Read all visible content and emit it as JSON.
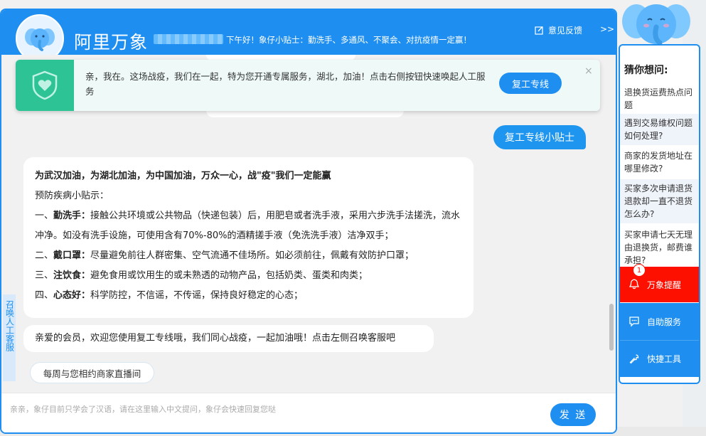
{
  "header": {
    "brand": "阿里万象",
    "greeting": "下午好！象仔小贴士：勤洗手、多通风、不聚会、对抗疫情一定赢！",
    "feedback_label": "意见反馈",
    "collapse_label": ">>"
  },
  "banner": {
    "text": "亲，我在。这场战疫，我们在一起，特为您开通专属服务，湖北，加油！点击右侧按钮快速唤起人工服务",
    "button_label": "复工专线",
    "close_label": "×"
  },
  "chat": {
    "user_message": "复工专线小贴士",
    "bot_message": {
      "title": "为武汉加油，为湖北加油，为中国加油，万众一心，战\"疫\"我们一定能赢",
      "subtitle": "预防疾病小贴示：",
      "tips": [
        {
          "prefix": "一、",
          "head": "勤洗手：",
          "body": "接触公共环境或公共物品（快递包装）后，用肥皂或者洗手液，采用六步洗手法搓洗，流水冲净。如没有洗手设施，可使用含有70%-80%的酒精搓手液（免洗洗手液）洁净双手；"
        },
        {
          "prefix": "二、",
          "head": "戴口罩：",
          "body": "尽量避免前往人群密集、空气流通不佳场所。如必须前往，佩戴有效防护口罩；"
        },
        {
          "prefix": "三、",
          "head": "注饮食：",
          "body": "避免食用或饮用生的或未熟透的动物产品，包括奶类、蛋类和肉类；"
        },
        {
          "prefix": "四、",
          "head": "心态好：",
          "body": "科学防控，不信谣，不传谣，保持良好稳定的心态；"
        }
      ]
    },
    "bot_message_2": "亲爱的会员，欢迎您使用复工专线哦，我们同心战疫，一起加油哦！点击左侧召唤客服吧",
    "quick_reply": "每周与您相约商家直播间",
    "summon_label": "召唤人工客服"
  },
  "input": {
    "placeholder": "亲亲，象仔目前只学会了汉语，请在这里输入中文提问，象仔会快速回复您哒",
    "value": "",
    "send_label": "发 送"
  },
  "side_panel": {
    "title": "猜你想问:",
    "questions": [
      "退换货运费热点问题",
      "遇到交易维权问题如何处理?",
      "商家的发货地址在哪里修改?",
      "买家多次申请退货退款却一直不退货怎么办?",
      "买家申请七天无理由退换货，邮费谁承担?"
    ],
    "alert": {
      "label": "万象提醒",
      "count": "1"
    },
    "self_service_label": "自助服务",
    "tools_label": "快捷工具"
  },
  "colors": {
    "brand_blue": "#1e8ff0",
    "banner_green": "#2ec394",
    "alert_red": "#fe1000"
  },
  "icons": [
    "elephant-mascot-icon",
    "shield-heart-icon",
    "edit-icon",
    "bell-icon",
    "chat-icon",
    "wrench-icon",
    "close-icon"
  ]
}
